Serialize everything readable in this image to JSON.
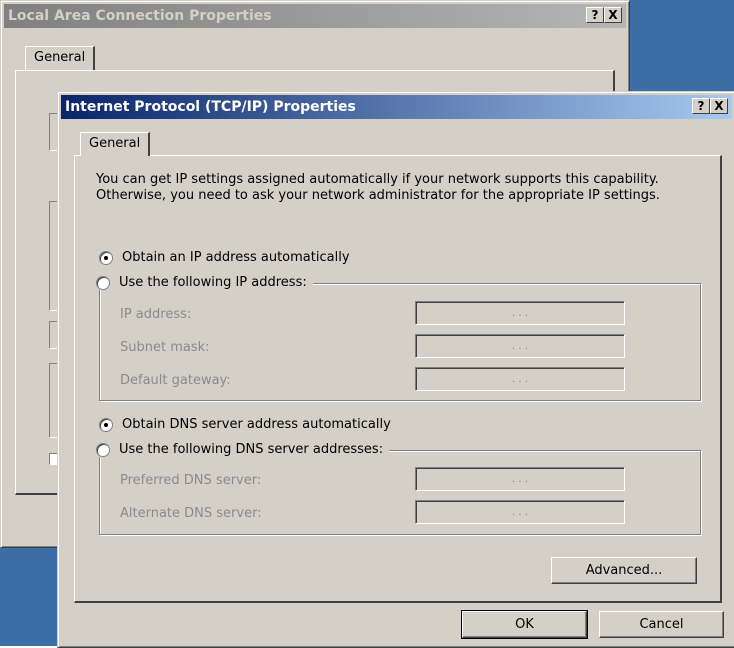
{
  "back_window": {
    "title": "Local Area Connection Properties",
    "tab": "General",
    "title_buttons": [
      "?",
      "X"
    ]
  },
  "dialog": {
    "title": "Internet Protocol (TCP/IP) Properties",
    "title_buttons": [
      "?",
      "X"
    ],
    "tab": "General",
    "description": "You can get IP settings assigned automatically if your network supports this capability. Otherwise, you need to ask your network administrator for the appropriate IP settings.",
    "ip_auto": {
      "label": "Obtain an IP address automatically",
      "checked": true
    },
    "ip_manual": {
      "label": "Use the following IP address:",
      "checked": false
    },
    "ip_fields": [
      {
        "label": "IP address:",
        "dots": ". . ."
      },
      {
        "label": "Subnet mask:",
        "dots": ". . ."
      },
      {
        "label": "Default gateway:",
        "dots": ". . ."
      }
    ],
    "dns_auto": {
      "label": "Obtain DNS server address automatically",
      "checked": true
    },
    "dns_manual": {
      "label": "Use the following DNS server addresses:",
      "checked": false
    },
    "dns_fields": [
      {
        "label": "Preferred DNS server:",
        "dots": ". . ."
      },
      {
        "label": "Alternate DNS server:",
        "dots": ". . ."
      }
    ],
    "advanced_label": "Advanced...",
    "ok_label": "OK",
    "cancel_label": "Cancel"
  },
  "colors": {
    "face": "#d4d0c8",
    "active_title": "#0a246a",
    "inactive_title": "#808080",
    "desktop": "#3a6ea5"
  }
}
